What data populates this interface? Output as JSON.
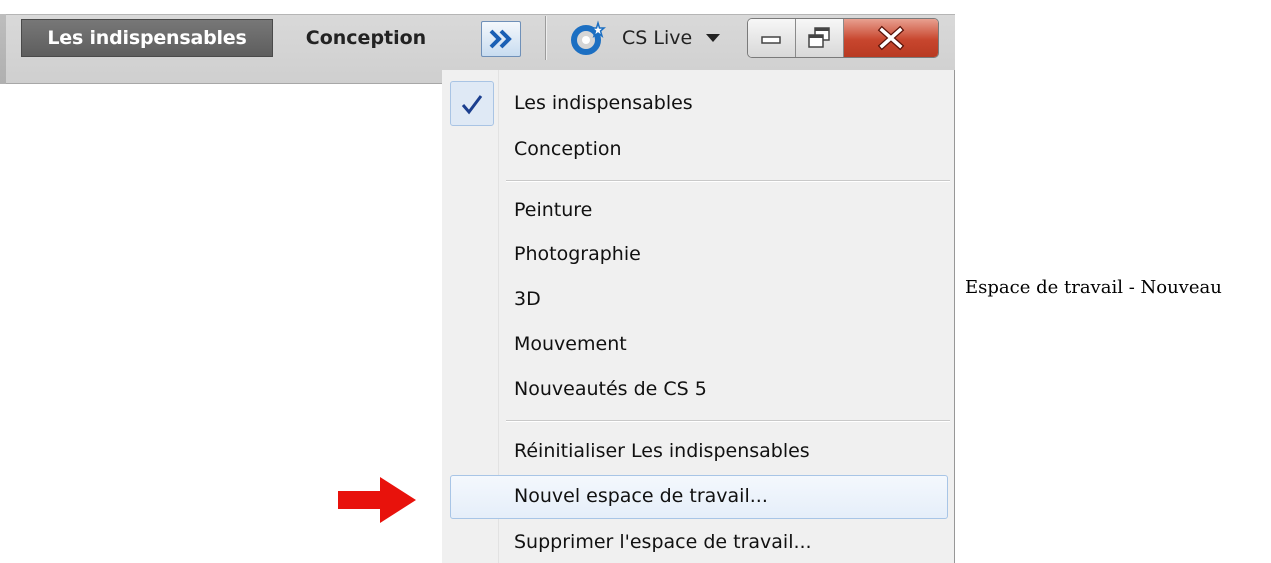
{
  "toolbar": {
    "active_workspace": "Les indispensables",
    "workspace_tab": "Conception",
    "cslive_label": "CS Live",
    "more_icon": "double-chevron-right-icon",
    "window_buttons": [
      "minimize-icon",
      "restore-icon",
      "close-icon"
    ]
  },
  "menu": {
    "checked_icon": "checkmark-icon",
    "group1": [
      "Les indispensables",
      "Conception"
    ],
    "group2": [
      "Peinture",
      "Photographie",
      "3D",
      "Mouvement",
      "Nouveautés de CS 5"
    ],
    "group3": [
      "Réinitialiser Les indispensables",
      "Nouvel espace de travail...",
      "Supprimer l'espace de travail..."
    ],
    "highlighted": "Nouvel espace de travail..."
  },
  "annotation": {
    "arrow_color": "#e8120c",
    "caption": "Espace de travail - Nouveau"
  },
  "colors": {
    "close_button": "#c8462e",
    "highlight_border": "#a8c5e6",
    "more_button_border": "#6f90b8"
  }
}
